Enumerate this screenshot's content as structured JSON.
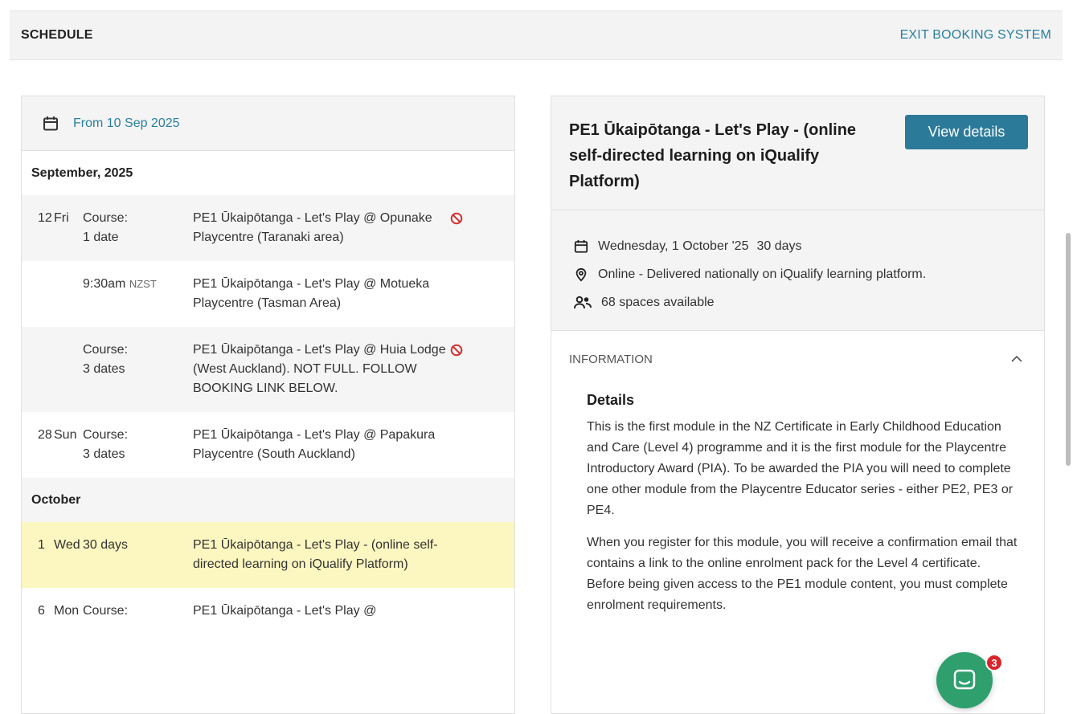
{
  "header": {
    "title": "SCHEDULE",
    "exit_label": "EXIT BOOKING SYSTEM"
  },
  "schedule": {
    "from_label": "From 10 Sep 2025",
    "months": [
      {
        "label": "September, 2025",
        "events": [
          {
            "day": "12",
            "dow": "Fri",
            "type_line1": "Course:",
            "type_line2": "1 date",
            "title": "PE1 Ūkaipōtanga - Let's Play @ Opunake Playcentre (Taranaki area)",
            "full": true
          },
          {
            "day": "",
            "dow": "",
            "time": "9:30am",
            "tz": "NZST",
            "title": "PE1 Ūkaipōtanga - Let's Play @ Motueka Playcentre (Tasman Area)",
            "full": false
          },
          {
            "day": "",
            "dow": "",
            "type_line1": "Course:",
            "type_line2": "3 dates",
            "title": "PE1 Ūkaipōtanga - Let's Play @ Huia Lodge (West Auckland). NOT FULL. FOLLOW BOOKING LINK BELOW.",
            "full": true
          },
          {
            "day": "28",
            "dow": "Sun",
            "type_line1": "Course:",
            "type_line2": "3 dates",
            "title": "PE1 Ūkaipōtanga - Let's Play @ Papakura Playcentre (South Auckland)",
            "full": false
          }
        ]
      },
      {
        "label": "October",
        "events": [
          {
            "day": "1",
            "dow": "Wed",
            "type_line1": "30 days",
            "type_line2": "",
            "title": "PE1 Ūkaipōtanga - Let's Play - (online self-directed learning on iQualify Platform)",
            "full": false,
            "selected": true
          },
          {
            "day": "6",
            "dow": "Mon",
            "type_line1": "Course:",
            "type_line2": "",
            "title": "PE1 Ūkaipōtanga - Let's Play @",
            "full": false
          }
        ]
      }
    ]
  },
  "detail": {
    "title": "PE1 Ūkaipōtanga - Let's Play - (online self-directed learning on iQualify Platform)",
    "view_button": "View details",
    "date": "Wednesday, 1 October '25",
    "duration": "30 days",
    "location": "Online - Delivered nationally on iQualify learning platform.",
    "spaces": "68 spaces available",
    "info_heading": "INFORMATION",
    "details_heading": "Details",
    "paragraphs": [
      "This is the first module in the NZ Certificate in Early Childhood Education and Care (Level 4) programme and it is the first module for the Playcentre Introductory Award (PIA). To be awarded the PIA you will need to complete one other module from the Playcentre Educator series - either PE2, PE3 or PE4.",
      "When you register for this module, you will receive a confirmation email that contains a link to the online enrolment pack for the Level 4 certificate. Before being given access to the PE1 module content, you must complete enrolment requirements."
    ]
  },
  "chat": {
    "badge_count": "3"
  },
  "colors": {
    "accent": "#2a7f9e",
    "button": "#2b7a99",
    "highlight": "#fcf6c0",
    "full_icon": "#d32f2f",
    "chat": "#2e9f6d"
  }
}
